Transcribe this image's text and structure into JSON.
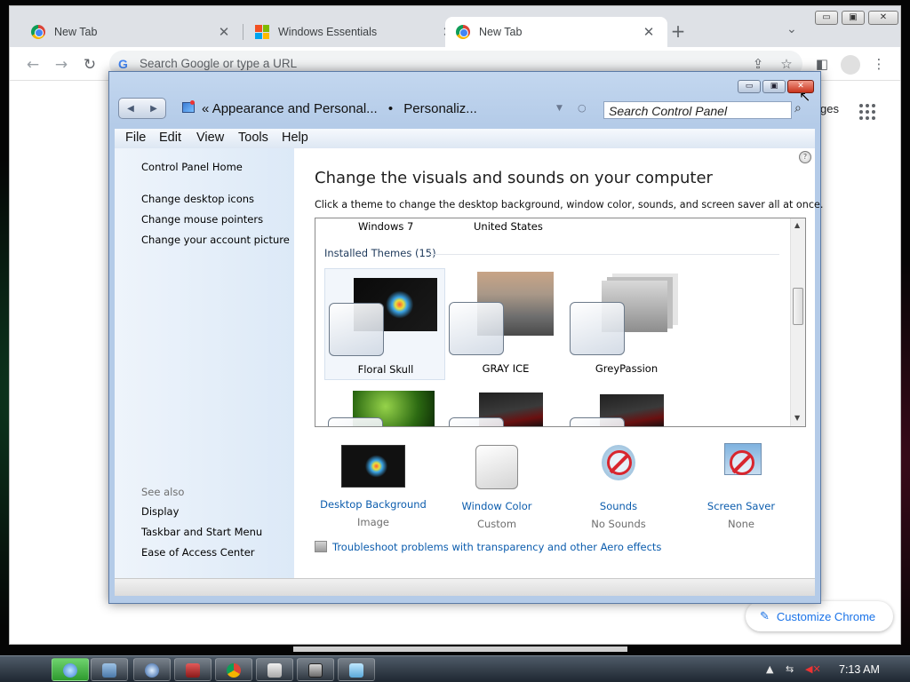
{
  "chrome": {
    "tabs": [
      {
        "title": "New Tab",
        "favicon": "chrome-icon"
      },
      {
        "title": "Windows Essentials",
        "favicon": "windows-icon"
      },
      {
        "title": "New Tab",
        "favicon": "chrome-icon"
      }
    ],
    "active_tab": 2,
    "omnibox_placeholder": "Search Google or type a URL",
    "page_peek_text": "ges",
    "customize_label": "Customize Chrome"
  },
  "control_panel": {
    "breadcrumb": [
      "Appearance and Personal...",
      "Personaliz..."
    ],
    "breadcrumb_prefix": "«",
    "breadcrumb_separator": "•",
    "search_placeholder": "Search Control Panel",
    "menu": [
      "File",
      "Edit",
      "View",
      "Tools",
      "Help"
    ],
    "sidebar": {
      "home": "Control Panel Home",
      "tasks": [
        "Change desktop icons",
        "Change mouse pointers",
        "Change your account picture"
      ],
      "see_also_title": "See also",
      "see_also": [
        "Display",
        "Taskbar and Start Menu",
        "Ease of Access Center"
      ]
    },
    "headline": "Change the visuals and sounds on your computer",
    "subline": "Click a theme to change the desktop background, window color, sounds, and screen saver all at once.",
    "partial_row": [
      "Windows 7",
      "United States"
    ],
    "installed_title": "Installed Themes (15)",
    "themes": [
      {
        "name": "Floral Skull",
        "selected": true
      },
      {
        "name": "GRAY ICE",
        "selected": false
      },
      {
        "name": "GreyPassion",
        "selected": false
      }
    ],
    "settings": [
      {
        "name": "Desktop Background",
        "value": "Image"
      },
      {
        "name": "Window Color",
        "value": "Custom"
      },
      {
        "name": "Sounds",
        "value": "No Sounds"
      },
      {
        "name": "Screen Saver",
        "value": "None"
      }
    ],
    "troubleshoot_link": "Troubleshoot problems with transparency and other Aero effects"
  },
  "taskbar": {
    "clock": "7:13 AM"
  },
  "colors": {
    "link_blue": "#0b5cad",
    "chrome_accent": "#1a73e8",
    "close_red": "#c9331c"
  }
}
